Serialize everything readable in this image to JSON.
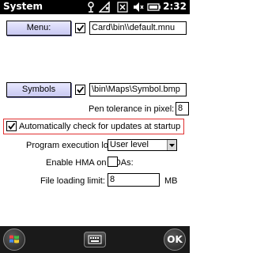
{
  "status_bar": {
    "title": "System",
    "time": "2:32",
    "icons": [
      "connectivity-icon",
      "signal-icon",
      "data-icon",
      "volume-icon",
      "battery-icon"
    ]
  },
  "menu_row": {
    "button_label": "Menu:",
    "checked": true,
    "path_value": "Card\\bin\\\\default.mnu"
  },
  "symbols_row": {
    "button_label": "Symbols",
    "checked": true,
    "path_value": "\\bin\\Maps\\Symbol.bmp"
  },
  "pen_tolerance": {
    "label": "Pen tolerance in pixel:",
    "value": "8"
  },
  "auto_update": {
    "label": "Automatically check for updates at startup",
    "checked": true
  },
  "execution_log": {
    "label": "Program execution log:",
    "selected": "User level"
  },
  "hma": {
    "label": "Enable HMA on PDAs:",
    "checked": false
  },
  "file_limit": {
    "label": "File loading limit:",
    "value": "8",
    "unit": "MB"
  },
  "bottom_bar": {
    "ok_label": "OK",
    "icons": [
      "windows-start-icon",
      "keyboard-icon"
    ]
  },
  "colors": {
    "highlight": "#e03030",
    "button_gradient_top": "#e9e9ff",
    "button_gradient_bottom": "#c8c8f2"
  }
}
